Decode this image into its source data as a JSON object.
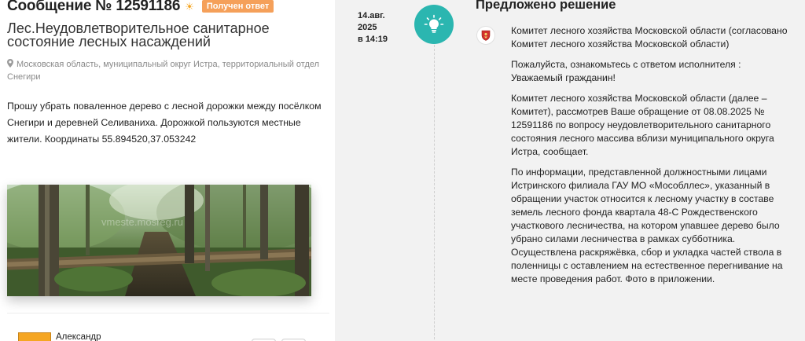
{
  "message": {
    "title": "Сообщение № 12591186",
    "badge": "Получен ответ",
    "subject": "Лес.Неудовлетворительное санитарное состояние лесных насаждений",
    "location": "Московская область, муниципальный округ Истра, территориальный отдел Снегири",
    "text": "Прошу убрать поваленное дерево с лесной дорожки между посёлком Снегири и деревней Селиваниха. Дорожкой пользуются местные жители. Координаты 55.894520,37.053242",
    "photo_watermark": "vmeste.mosreg.ru",
    "author_name": "Александр"
  },
  "timeline": {
    "date": "14.авг. 2025",
    "time": "в 14:19",
    "icon": "lightbulb-icon",
    "accent_color": "#2bb6b0"
  },
  "solution": {
    "title": "Предложено решение",
    "org": "Комитет лесного хозяйства Московской области (согласовано Комитет лесного хозяйства Московской области)",
    "intro": "Пожалуйста, ознакомьтесь с ответом исполнителя : Уважаемый гражданин!",
    "p1": "Комитет лесного хозяйства Московской области (далее – Комитет), рассмотрев Ваше обращение от 08.08.2025 № 12591186 по вопросу неудовлетворительного санитарного состояния лесного массива вблизи муниципального округа Истра, сообщает.",
    "p2": "По информации, представленной должностными лицами Истринского филиала ГАУ МО «Мособллес», указанный в обращении участок относится к лесному участку в составе земель лесного фонда квартала 48-С Рождественского участкового лесничества, на котором упавшее дерево было убрано силами лесничества в рамках субботника. Осуществлена раскряжёвка, сбор и укладка частей ствола в поленницы с оставлением на естественное перегнивание на месте проведения работ. Фото в приложении."
  }
}
